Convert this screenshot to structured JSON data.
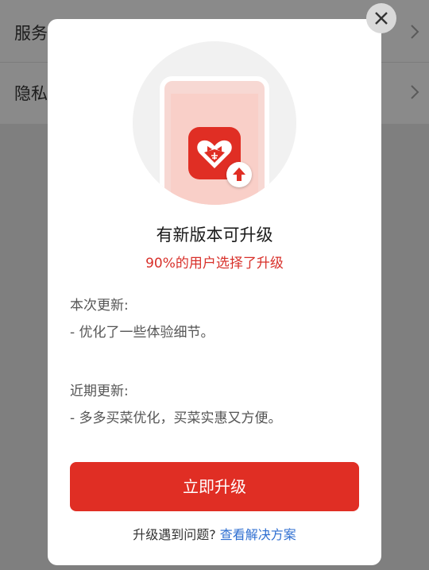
{
  "background": {
    "rows": [
      {
        "label": "服务"
      },
      {
        "label": "隐私"
      }
    ]
  },
  "dialog": {
    "title": "有新版本可升级",
    "subtitle": "90%的用户选择了升级",
    "current_update": {
      "heading": "本次更新:",
      "item": "- 优化了一些体验细节。"
    },
    "recent_update": {
      "heading": "近期更新:",
      "item": "- 多多买菜优化，买菜实惠又方便。"
    },
    "upgrade_button": "立即升级",
    "footer_text": "升级遇到问题?",
    "footer_link": "查看解决方案"
  },
  "colors": {
    "brand_red": "#e02e24",
    "link_blue": "#2f6fd1"
  },
  "icons": [
    "chevron-right-icon",
    "close-icon",
    "app-icon",
    "upgrade-arrow-icon"
  ]
}
